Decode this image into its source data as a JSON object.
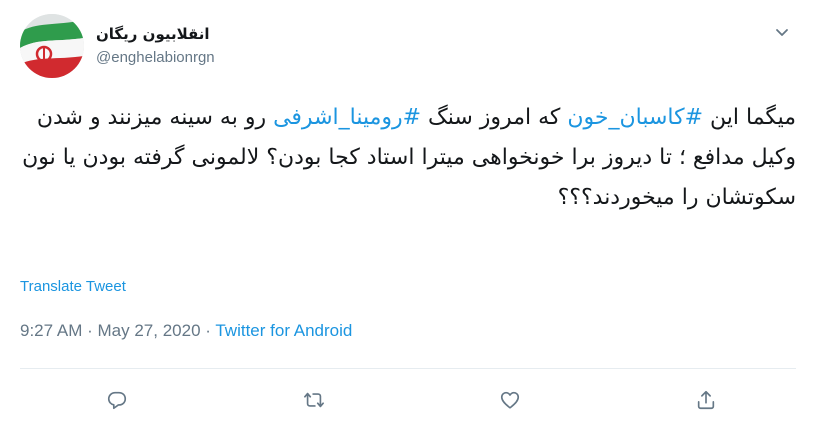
{
  "tweet": {
    "display_name": "انقلابیون ریگان",
    "handle": "@enghelabionrgn",
    "text_segments": [
      {
        "text": "میگما این ",
        "hashtag": false
      },
      {
        "text": "#کاسبان_خون",
        "hashtag": true
      },
      {
        "text": " که امروز سنگ ",
        "hashtag": false
      },
      {
        "text": "#رومینا_اشرفی",
        "hashtag": true
      },
      {
        "text": " رو به سینه میزنند و شدن وکیل مدافع ؛ تا دیروز برا خونخواهی میترا استاد کجا بودن؟ لالمونی گرفته بودن یا نون سکوتشان را میخوردند؟؟؟",
        "hashtag": false
      }
    ],
    "translate_label": "Translate Tweet",
    "time": "9:27 AM",
    "separator": "·",
    "date": "May 27, 2020",
    "source": "Twitter for Android"
  },
  "icons": {
    "caret": "chevron-down-icon",
    "reply": "reply-icon",
    "retweet": "retweet-icon",
    "like": "heart-icon",
    "share": "share-icon"
  },
  "colors": {
    "link": "#1b95e0",
    "muted": "#657786",
    "text": "#14171a"
  }
}
